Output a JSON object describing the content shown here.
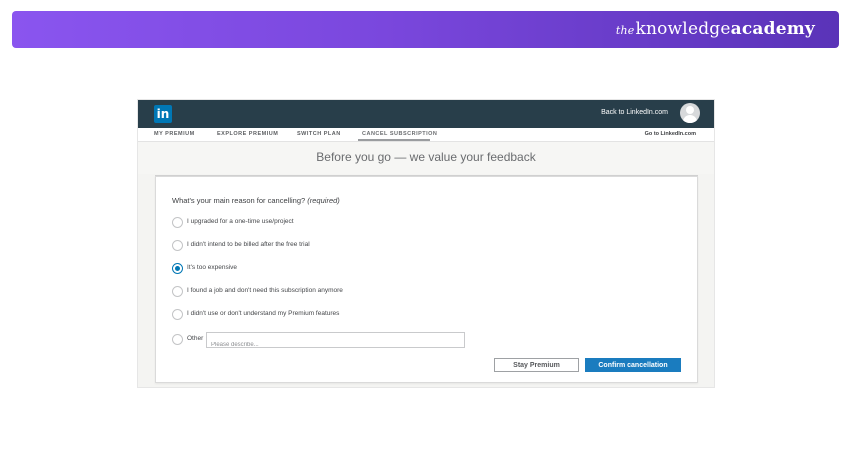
{
  "brand": {
    "prefix": "the",
    "main": "knowledge",
    "bold": "academy"
  },
  "topbar": {
    "logo": "in",
    "back_link": "Back to LinkedIn.com"
  },
  "tabs": [
    {
      "label": "MY PREMIUM"
    },
    {
      "label": "EXPLORE PREMIUM"
    },
    {
      "label": "SWITCH PLAN"
    },
    {
      "label": "CANCEL SUBSCRIPTION"
    }
  ],
  "goto_link": "Go to LinkedIn.com",
  "heading": "Before you go — we value your feedback",
  "form": {
    "question": "What's your main reason for cancelling?",
    "required": "(required)",
    "options": [
      {
        "label": "I upgraded for a one-time use/project",
        "checked": false
      },
      {
        "label": "I didn't intend to be billed after the free trial",
        "checked": false
      },
      {
        "label": "It's too expensive",
        "checked": true
      },
      {
        "label": "I found a job and don't need this subscription anymore",
        "checked": false
      },
      {
        "label": "I didn't use or don't understand my Premium features",
        "checked": false
      },
      {
        "label": "Other",
        "checked": false
      }
    ],
    "other_placeholder": "Please describe...",
    "other_value": ""
  },
  "buttons": {
    "stay": "Stay Premium",
    "confirm": "Confirm cancellation"
  },
  "colors": {
    "banner_start": "#8a55ef",
    "banner_end": "#5a33b8",
    "linkedin_blue": "#0077b5",
    "topbar": "#283e4a",
    "confirm": "#1a7cbf"
  }
}
